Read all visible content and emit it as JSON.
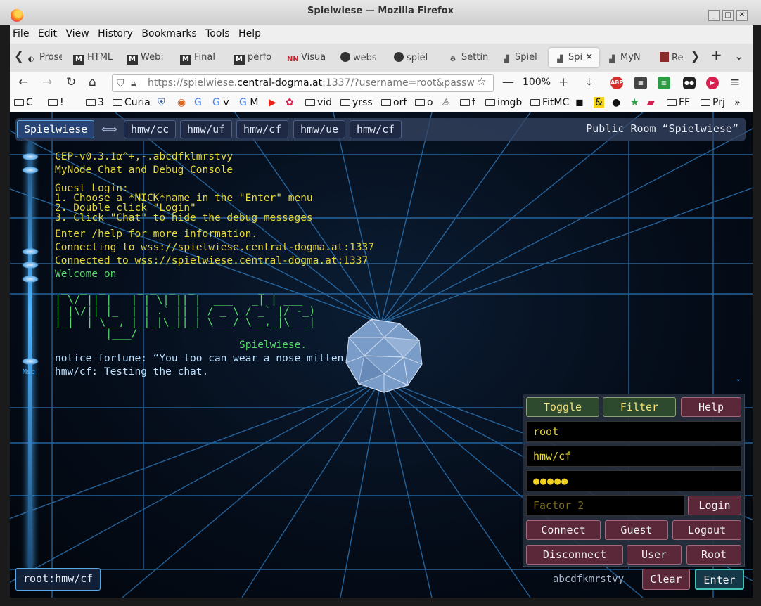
{
  "window": {
    "title": "Spielwiese — Mozilla Firefox"
  },
  "menu": [
    "File",
    "Edit",
    "View",
    "History",
    "Bookmarks",
    "Tools",
    "Help"
  ],
  "tabs": [
    {
      "label": "Prose",
      "icon": "circle-o"
    },
    {
      "label": "HTML",
      "icon": "M"
    },
    {
      "label": "Web:",
      "icon": "M"
    },
    {
      "label": "Final",
      "icon": "M"
    },
    {
      "label": "perfo",
      "icon": "M"
    },
    {
      "label": "Visua",
      "icon": "NN"
    },
    {
      "label": "webs",
      "icon": "github"
    },
    {
      "label": "spiel",
      "icon": "github"
    },
    {
      "label": "Settin",
      "icon": "gear"
    },
    {
      "label": "Spiel",
      "icon": "graph"
    },
    {
      "label": "Spi",
      "icon": "graph"
    },
    {
      "label": "MyN",
      "icon": "graph"
    },
    {
      "label": "Re",
      "icon": "box"
    }
  ],
  "nav": {
    "url_prefix": "https://spielwiese.",
    "url_host": "central-dogma.at",
    "url_rest": ":1337/?username=root&passw",
    "zoom": "100%"
  },
  "bookmarks": [
    "C",
    "!",
    "3",
    "Curia",
    "G",
    "v",
    "M",
    "vid",
    "yrss",
    "orf",
    "o",
    "f",
    "imgb",
    "FitMC",
    "FF",
    "Prj"
  ],
  "app": {
    "channels": [
      "Spielwiese",
      "hmw/cc",
      "hmw/uf",
      "hmw/cf",
      "hmw/ue",
      "hmw/cf"
    ],
    "room_title": "Public Room “Spielwiese”",
    "console": {
      "version": "CEP-v0.3.1α^+,-.abcdfklmrstvy",
      "subtitle": "MyNode Chat and Debug Console",
      "guest_head": "Guest Login:",
      "step1": "1. Choose a *NICK*name in the \"Enter\" menu",
      "step2": "2. Double click \"Login\"",
      "step3": "3. Click \"Chat\" to hide the debug messages",
      "help": "Enter /help for more information.",
      "connecting": "Connecting to wss://spielwiese.central-dogma.at:1337",
      "connected": "Connected to wss://spielwiese.central-dogma.at:1337",
      "welcome": "Welcome on",
      "ascii_art": " _  _  _     _ _  _  _          _     \n| \\/ || |   | | \\| || |  ___   _| | ___ \n| |\\/|| |_  | | .` || | / _ \\ / _` |/ -_)\n|_|  | \\__, |_|_|\\_||_| \\___/ \\__,_|\\___|\n        |___/                            ",
      "server_name": "Spielwiese.",
      "notice": "notice fortune: “You too can wear a nose mitten.”",
      "chat_line": "hmw/cf: Testing the chat."
    },
    "timeline_msg_label": "Msg",
    "panel": {
      "toggle": "Toggle",
      "filter": "Filter",
      "help": "Help",
      "user_value": "root",
      "room_value": "hmw/cf",
      "password_dots": "●●●●●",
      "factor_placeholder": "Factor 2",
      "login": "Login",
      "connect": "Connect",
      "guest": "Guest",
      "logout": "Logout",
      "disconnect": "Disconnect",
      "user": "User",
      "root": "Root"
    },
    "bottom": {
      "identity": "root:hmw/cf",
      "charset": "abcdfkmrstvy",
      "clear": "Clear",
      "enter": "Enter"
    }
  }
}
